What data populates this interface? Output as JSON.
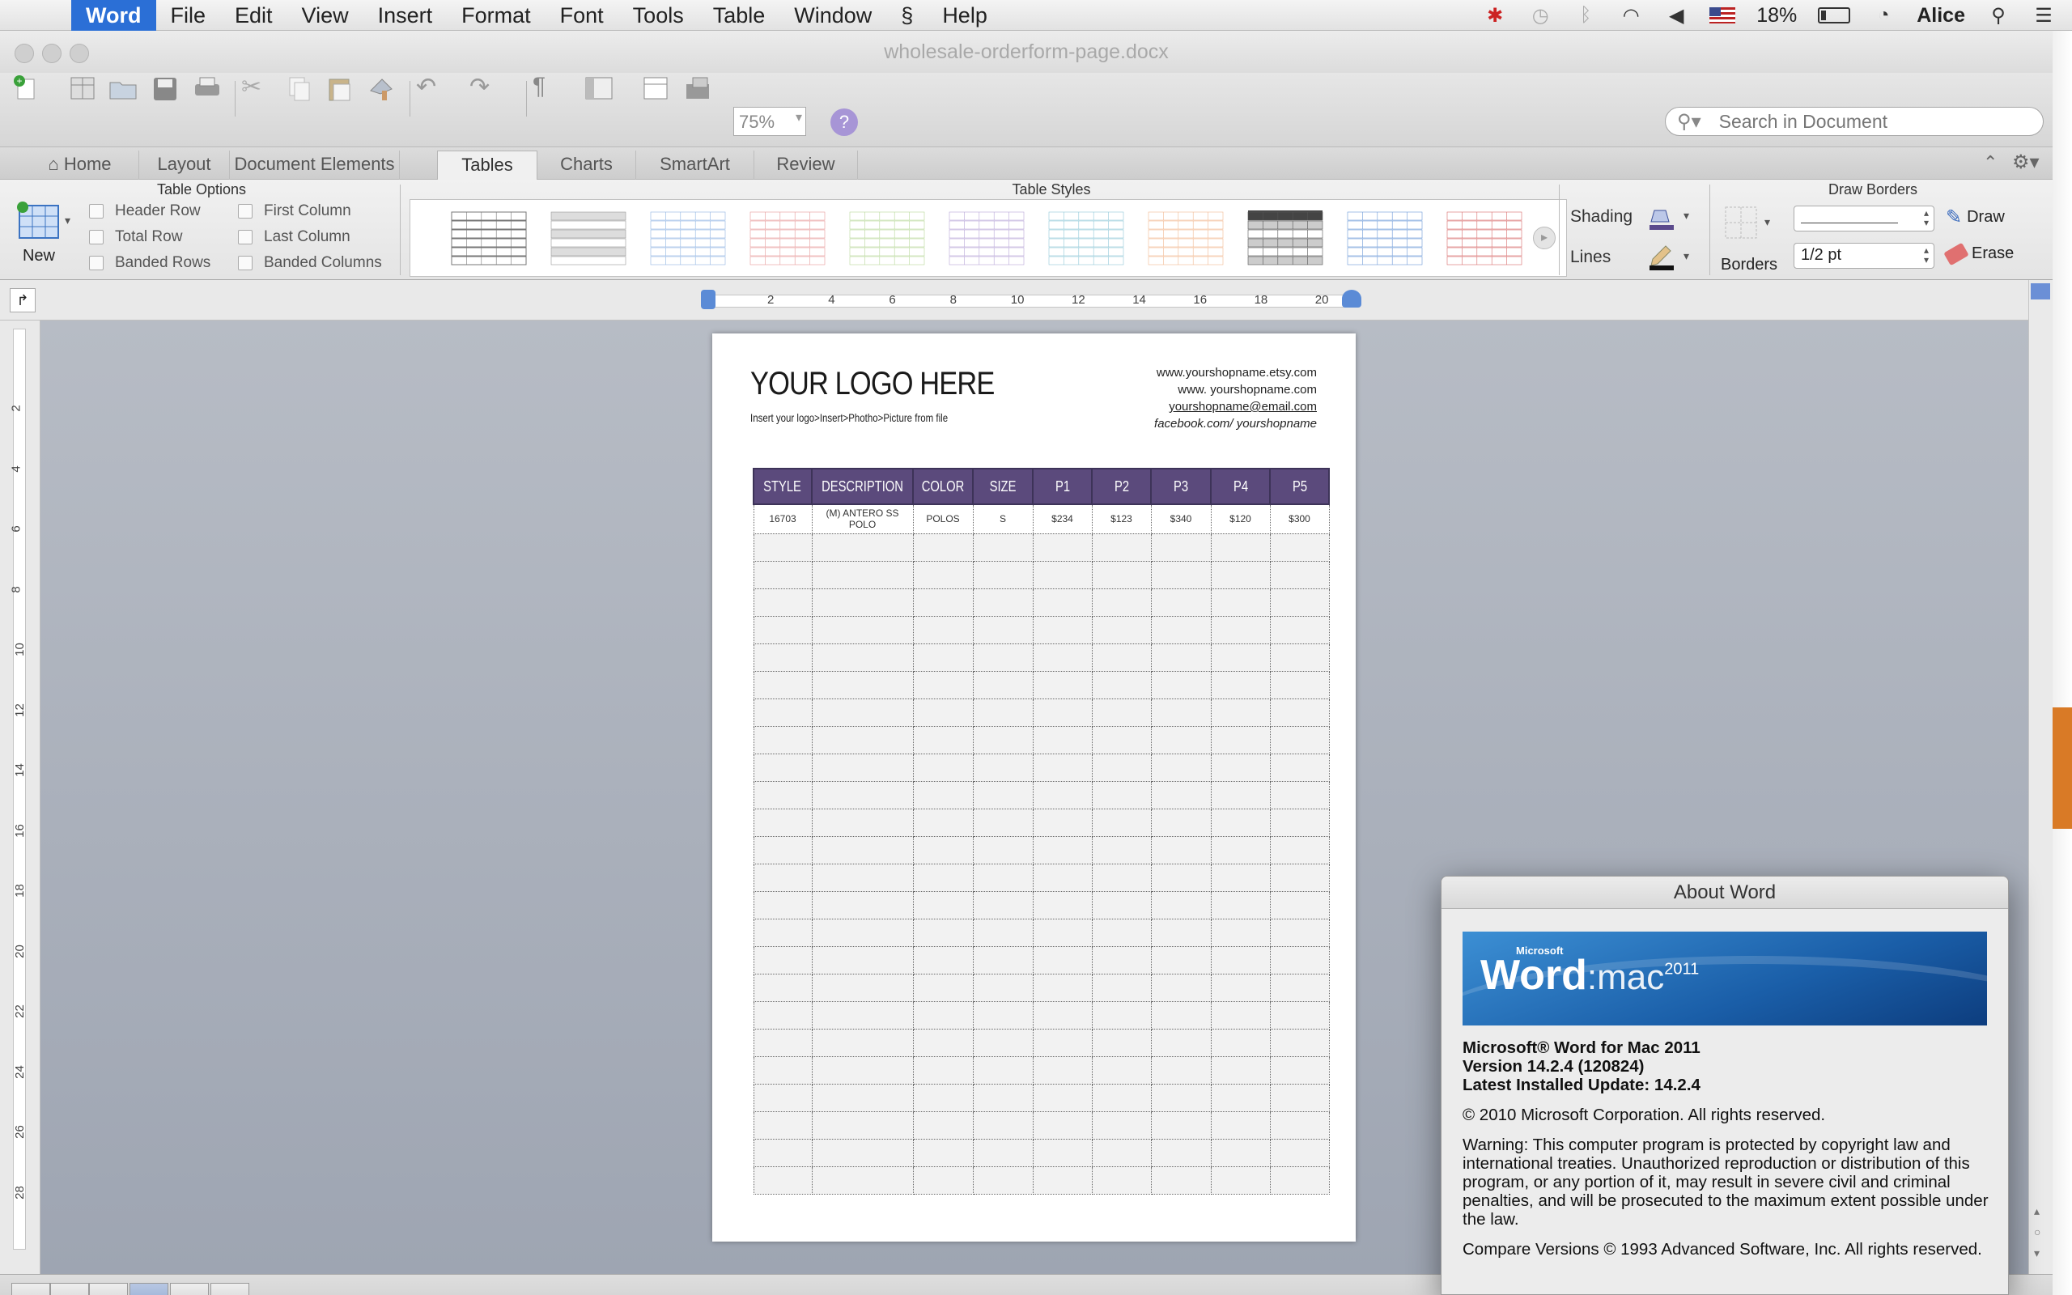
{
  "menubar": {
    "app_name": "Word",
    "items": [
      "File",
      "Edit",
      "View",
      "Insert",
      "Format",
      "Font",
      "Tools",
      "Table",
      "Window",
      "Help"
    ],
    "battery": "18%",
    "user": "Alice"
  },
  "window": {
    "title": "wholesale-orderform-page.docx"
  },
  "toolbar": {
    "zoom": "75%",
    "search_placeholder": "Search in Document"
  },
  "ribbon_tabs": [
    "Home",
    "Layout",
    "Document Elements",
    "Tables",
    "Charts",
    "SmartArt",
    "Review"
  ],
  "ribbon": {
    "table_options_title": "Table Options",
    "table_styles_title": "Table Styles",
    "draw_borders_title": "Draw Borders",
    "new_label": "New",
    "options": [
      "Header Row",
      "First Column",
      "Total Row",
      "Last Column",
      "Banded Rows",
      "Banded Columns"
    ],
    "shading_label": "Shading",
    "lines_label": "Lines",
    "borders_label": "Borders",
    "line_weight": "1/2 pt",
    "draw_label": "Draw",
    "erase_label": "Erase"
  },
  "ruler": {
    "h_ticks": [
      "2",
      "4",
      "6",
      "8",
      "10",
      "12",
      "14",
      "16",
      "18",
      "20"
    ],
    "v_ticks": [
      "2",
      "4",
      "6",
      "8",
      "10",
      "12",
      "14",
      "16",
      "18",
      "20",
      "22",
      "24",
      "26",
      "28"
    ]
  },
  "document": {
    "logo_title": "YOUR LOGO HERE",
    "logo_subtitle": "Insert your logo>Insert>Photho>Picture from file",
    "contacts": [
      "www.yourshopname.etsy.com",
      "www. yourshopname.com",
      "yourshopname@email.com",
      "facebook.com/ yourshopname"
    ],
    "table": {
      "headers": [
        "STYLE",
        "DESCRIPTION",
        "COLOR",
        "SIZE",
        "P1",
        "P2",
        "P3",
        "P4",
        "P5"
      ],
      "first_row": [
        "16703",
        "(M) ANTERO SS POLO",
        "POLOS",
        "S",
        "$234",
        "$123",
        "$340",
        "$120",
        "$300"
      ]
    }
  },
  "about": {
    "title": "About Word",
    "banner_brand": "Microsoft",
    "banner_word": "Word",
    "banner_mac": ":mac",
    "banner_year": "2011",
    "product": "Microsoft® Word for Mac 2011",
    "version": "Version 14.2.4 (120824)",
    "update": "Latest Installed Update: 14.2.4",
    "copyright": "© 2010 Microsoft Corporation. All rights reserved.",
    "warning": "Warning: This computer program is protected by copyright law and international treaties.  Unauthorized reproduction or distribution of this program, or any portion of it, may result in severe civil and criminal penalties, and will be prosecuted to the maximum extent possible under the law.",
    "compare": "Compare Versions © 1993 Advanced Software, Inc.  All rights reserved."
  }
}
